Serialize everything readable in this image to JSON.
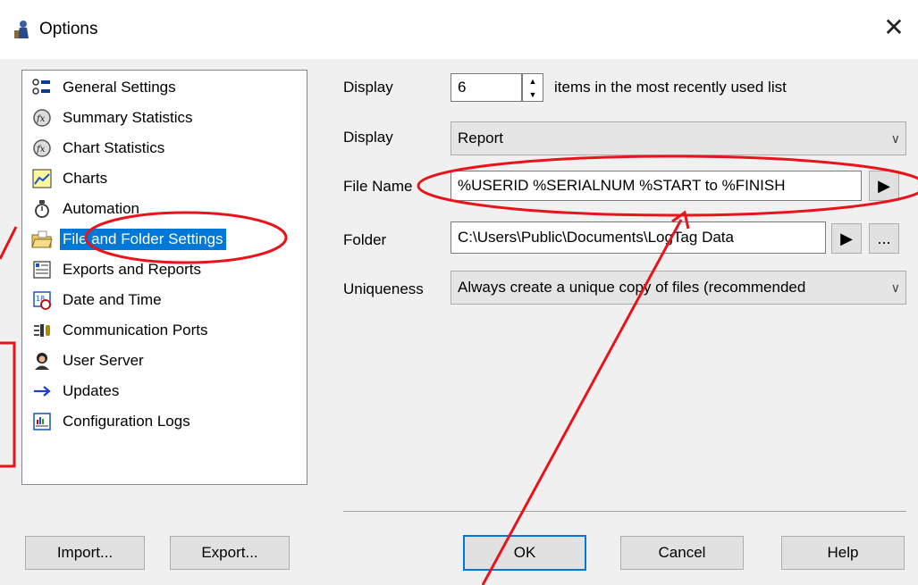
{
  "window": {
    "title": "Options",
    "close_glyph": "✕",
    "icon": "options-app-icon"
  },
  "nav": {
    "items": [
      {
        "label": "General Settings",
        "icon": "general-settings-icon"
      },
      {
        "label": "Summary Statistics",
        "icon": "summary-statistics-icon"
      },
      {
        "label": "Chart Statistics",
        "icon": "chart-statistics-icon"
      },
      {
        "label": "Charts",
        "icon": "charts-icon"
      },
      {
        "label": "Automation",
        "icon": "automation-icon"
      },
      {
        "label": "File and Folder Settings",
        "icon": "file-folder-icon",
        "selected": true
      },
      {
        "label": "Exports and Reports",
        "icon": "exports-reports-icon"
      },
      {
        "label": "Date and Time",
        "icon": "date-time-icon"
      },
      {
        "label": "Communication Ports",
        "icon": "communication-ports-icon"
      },
      {
        "label": "User Server",
        "icon": "user-server-icon"
      },
      {
        "label": "Updates",
        "icon": "updates-arrow-icon"
      },
      {
        "label": "Configuration Logs",
        "icon": "configuration-logs-icon"
      }
    ]
  },
  "form": {
    "display1_label": "Display",
    "display1_value": "6",
    "display1_suffix": "items in the most recently used list",
    "display2_label": "Display",
    "display2_value": "Report",
    "filename_label": "File Name",
    "filename_value": "%USERID %SERIALNUM %START to %FINISH",
    "folder_label": "Folder",
    "folder_value": "C:\\Users\\Public\\Documents\\LogTag Data",
    "browse_glyph": "...",
    "uniqueness_label": "Uniqueness",
    "uniqueness_value": "Always create a unique copy of files (recommended"
  },
  "buttons": {
    "import": "Import...",
    "export": "Export...",
    "ok": "OK",
    "cancel": "Cancel",
    "help": "Help"
  },
  "colors": {
    "selection": "#0078d7",
    "annotation": "#e8141c"
  }
}
